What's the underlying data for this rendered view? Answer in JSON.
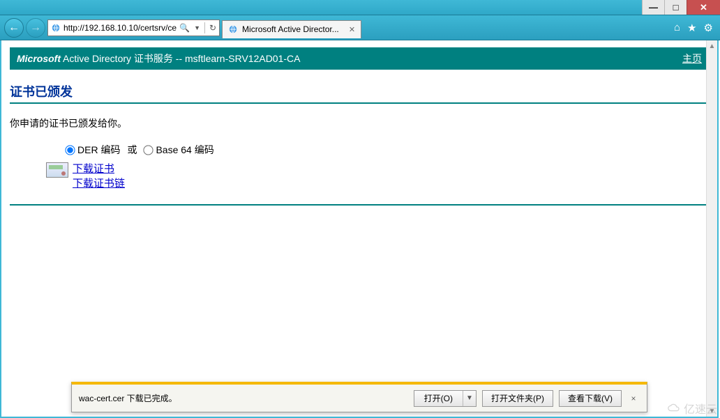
{
  "window": {
    "minimize": "—",
    "maximize": "□",
    "close": "✕"
  },
  "toolbar": {
    "nav_back": "←",
    "nav_fwd": "→",
    "url": "http://192.168.10.10/certsrv/ce",
    "search_glyph": "🔍",
    "refresh": "↻",
    "tab_title": "Microsoft Active Director...",
    "tab_close": "✕",
    "home_glyph": "⌂",
    "star_glyph": "★",
    "gear_glyph": "⚙"
  },
  "page": {
    "brand": "Microsoft",
    "header_title": " Active Directory 证书服务  --  msftlearn-SRV12AD01-CA",
    "home_link": "主页",
    "title": "证书已颁发",
    "issued_text": "你申请的证书已颁发给你。",
    "radio_der": "DER 编码",
    "or_text": "或",
    "radio_b64": "Base 64 编码",
    "link_download_cert": "下载证书",
    "link_download_chain": "下载证书链"
  },
  "download_bar": {
    "message": "wac-cert.cer 下载已完成。",
    "open": "打开(O)",
    "open_folder": "打开文件夹(P)",
    "view_downloads": "查看下载(V)",
    "close": "×"
  },
  "watermark": {
    "text": "亿速云"
  }
}
